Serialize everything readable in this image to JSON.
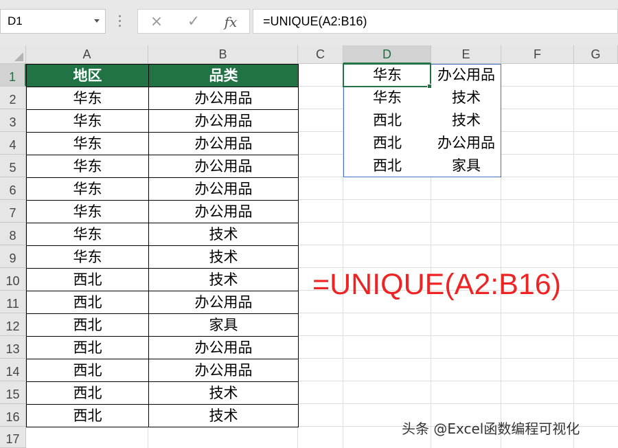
{
  "name_box": {
    "value": "D1"
  },
  "formula_bar": {
    "cancel_icon": "×",
    "enter_icon": "✓",
    "function_icon": "fx",
    "formula": "=UNIQUE(A2:B16)"
  },
  "columns": [
    "A",
    "B",
    "C",
    "D",
    "E",
    "F",
    "G"
  ],
  "rows": [
    "1",
    "2",
    "3",
    "4",
    "5",
    "6",
    "7",
    "8",
    "9",
    "10",
    "11",
    "12",
    "13",
    "14",
    "15",
    "16",
    "17"
  ],
  "source_table": {
    "headers": [
      "地区",
      "品类"
    ],
    "rows": [
      [
        "华东",
        "办公用品"
      ],
      [
        "华东",
        "办公用品"
      ],
      [
        "华东",
        "办公用品"
      ],
      [
        "华东",
        "办公用品"
      ],
      [
        "华东",
        "办公用品"
      ],
      [
        "华东",
        "办公用品"
      ],
      [
        "华东",
        "技术"
      ],
      [
        "华东",
        "技术"
      ],
      [
        "西北",
        "技术"
      ],
      [
        "西北",
        "办公用品"
      ],
      [
        "西北",
        "家具"
      ],
      [
        "西北",
        "办公用品"
      ],
      [
        "西北",
        "办公用品"
      ],
      [
        "西北",
        "技术"
      ],
      [
        "西北",
        "技术"
      ]
    ]
  },
  "unique_result": [
    [
      "华东",
      "办公用品"
    ],
    [
      "华东",
      "技术"
    ],
    [
      "西北",
      "技术"
    ],
    [
      "西北",
      "办公用品"
    ],
    [
      "西北",
      "家具"
    ]
  ],
  "annotation": "=UNIQUE(A2:B16)",
  "watermark": "头条 @Excel函数编程可视化",
  "colors": {
    "header_fill": "#217346",
    "selection": "#217346",
    "spill_border": "#3e70c4",
    "annotation": "#ee2424"
  }
}
